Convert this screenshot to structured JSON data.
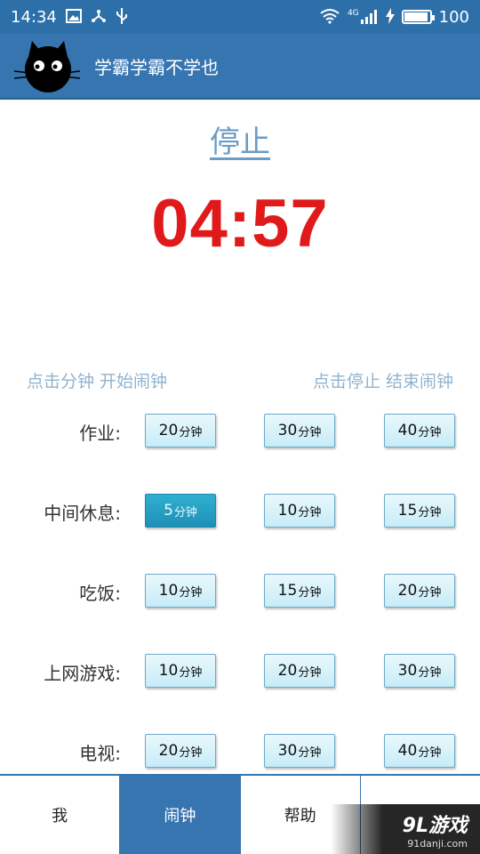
{
  "status_bar": {
    "time": "14:34",
    "network": "4G",
    "battery": "100",
    "battery_level": 1.0
  },
  "app_bar": {
    "title": "学霸学霸不学也",
    "logo_icon": "black-cat-icon"
  },
  "stop_label": "停止",
  "timer": "04:57",
  "hints": {
    "left": "点击分钟 开始闹钟",
    "right": "点击停止 结束闹钟"
  },
  "unit": "分钟",
  "rows": [
    {
      "label": "作业:",
      "options": [
        "20",
        "30",
        "40"
      ]
    },
    {
      "label": "中间休息:",
      "options": [
        "5",
        "10",
        "15"
      ]
    },
    {
      "label": "吃饭:",
      "options": [
        "10",
        "15",
        "20"
      ]
    },
    {
      "label": "上网游戏:",
      "options": [
        "10",
        "20",
        "30"
      ]
    },
    {
      "label": "电视:",
      "options": [
        "20",
        "30",
        "40"
      ]
    }
  ],
  "selected": {
    "row": 1,
    "option": 0
  },
  "bottom_nav": {
    "tabs": [
      "我",
      "闹钟",
      "帮助",
      ""
    ],
    "active": 1
  },
  "watermark": {
    "main": "9L游戏",
    "sub": "91danji.com"
  },
  "colors": {
    "primary": "#3775b0",
    "timer": "#e01a1a",
    "hint": "#8fb3cf",
    "button": "#c7ecf7",
    "button_selected": "#1f8fb6"
  }
}
